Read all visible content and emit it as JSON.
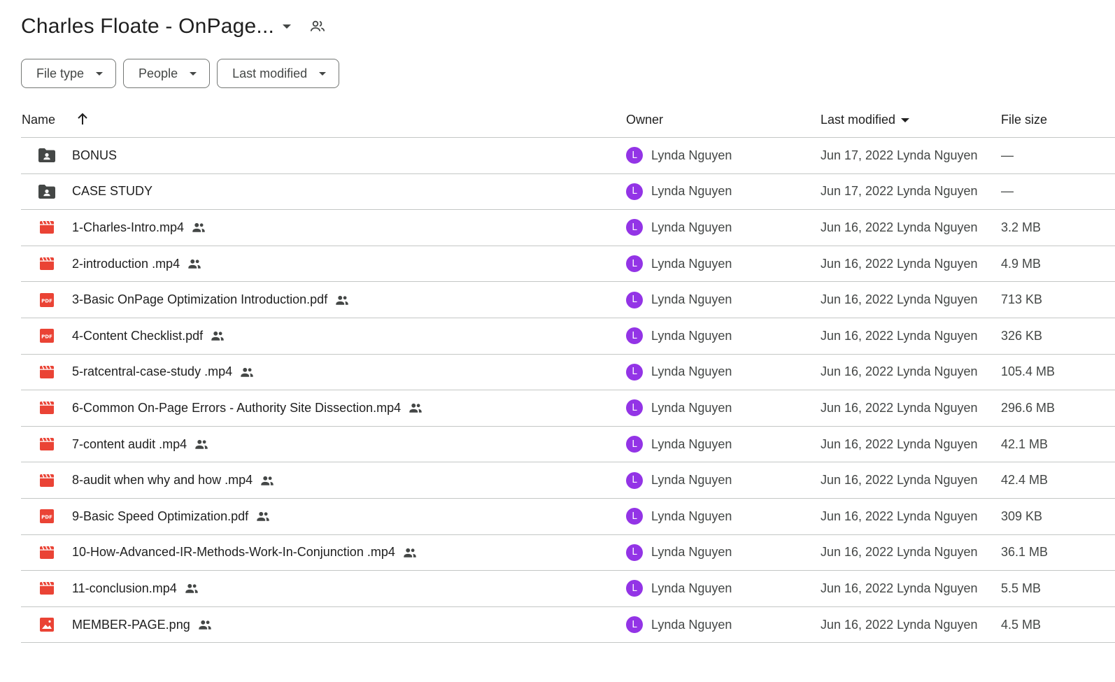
{
  "header": {
    "folder_title": "Charles Floate - OnPage...",
    "share_icon": "people-outline-icon"
  },
  "filters": [
    {
      "label": "File type"
    },
    {
      "label": "People"
    },
    {
      "label": "Last modified"
    }
  ],
  "columns": {
    "name": "Name",
    "owner": "Owner",
    "last_modified": "Last modified",
    "file_size": "File size"
  },
  "colors": {
    "avatar": "#9334e6",
    "folder_icon": "#444746",
    "file_icon_red": "#ea4335"
  },
  "files": [
    {
      "type": "shared-folder",
      "name": "BONUS",
      "shared": false,
      "owner": "Lynda Nguyen",
      "owner_initial": "L",
      "modified": "Jun 17, 2022 Lynda Nguyen",
      "size": "—"
    },
    {
      "type": "shared-folder",
      "name": "CASE STUDY",
      "shared": false,
      "owner": "Lynda Nguyen",
      "owner_initial": "L",
      "modified": "Jun 17, 2022 Lynda Nguyen",
      "size": "—"
    },
    {
      "type": "video",
      "name": "1-Charles-Intro.mp4",
      "shared": true,
      "owner": "Lynda Nguyen",
      "owner_initial": "L",
      "modified": "Jun 16, 2022 Lynda Nguyen",
      "size": "3.2 MB"
    },
    {
      "type": "video",
      "name": "2-introduction .mp4",
      "shared": true,
      "owner": "Lynda Nguyen",
      "owner_initial": "L",
      "modified": "Jun 16, 2022 Lynda Nguyen",
      "size": "4.9 MB"
    },
    {
      "type": "pdf",
      "name": "3-Basic OnPage Optimization Introduction.pdf",
      "shared": true,
      "owner": "Lynda Nguyen",
      "owner_initial": "L",
      "modified": "Jun 16, 2022 Lynda Nguyen",
      "size": "713 KB"
    },
    {
      "type": "pdf",
      "name": "4-Content Checklist.pdf",
      "shared": true,
      "owner": "Lynda Nguyen",
      "owner_initial": "L",
      "modified": "Jun 16, 2022 Lynda Nguyen",
      "size": "326 KB"
    },
    {
      "type": "video",
      "name": "5-ratcentral-case-study .mp4",
      "shared": true,
      "owner": "Lynda Nguyen",
      "owner_initial": "L",
      "modified": "Jun 16, 2022 Lynda Nguyen",
      "size": "105.4 MB"
    },
    {
      "type": "video",
      "name": "6-Common On-Page Errors - Authority Site Dissection.mp4",
      "shared": true,
      "owner": "Lynda Nguyen",
      "owner_initial": "L",
      "modified": "Jun 16, 2022 Lynda Nguyen",
      "size": "296.6 MB"
    },
    {
      "type": "video",
      "name": "7-content audit .mp4",
      "shared": true,
      "owner": "Lynda Nguyen",
      "owner_initial": "L",
      "modified": "Jun 16, 2022 Lynda Nguyen",
      "size": "42.1 MB"
    },
    {
      "type": "video",
      "name": "8-audit when why and how .mp4",
      "shared": true,
      "owner": "Lynda Nguyen",
      "owner_initial": "L",
      "modified": "Jun 16, 2022 Lynda Nguyen",
      "size": "42.4 MB"
    },
    {
      "type": "pdf",
      "name": "9-Basic Speed Optimization.pdf",
      "shared": true,
      "owner": "Lynda Nguyen",
      "owner_initial": "L",
      "modified": "Jun 16, 2022 Lynda Nguyen",
      "size": "309 KB"
    },
    {
      "type": "video",
      "name": "10-How-Advanced-IR-Methods-Work-In-Conjunction .mp4",
      "shared": true,
      "owner": "Lynda Nguyen",
      "owner_initial": "L",
      "modified": "Jun 16, 2022 Lynda Nguyen",
      "size": "36.1 MB"
    },
    {
      "type": "video",
      "name": "11-conclusion.mp4",
      "shared": true,
      "owner": "Lynda Nguyen",
      "owner_initial": "L",
      "modified": "Jun 16, 2022 Lynda Nguyen",
      "size": "5.5 MB"
    },
    {
      "type": "image",
      "name": "MEMBER-PAGE.png",
      "shared": true,
      "owner": "Lynda Nguyen",
      "owner_initial": "L",
      "modified": "Jun 16, 2022 Lynda Nguyen",
      "size": "4.5 MB"
    }
  ]
}
